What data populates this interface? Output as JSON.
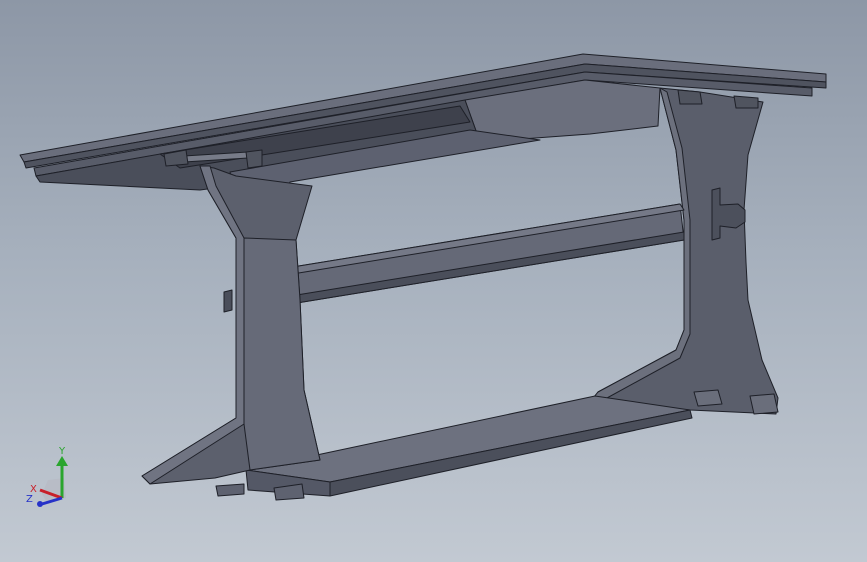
{
  "viewport": {
    "background_top": "#8d97a6",
    "background_bottom": "#c2c9d2"
  },
  "model": {
    "part_color": "#5e6270",
    "edge_color": "#1e2028"
  },
  "triad": {
    "x_label": "X",
    "y_label": "Y",
    "z_label": "Z",
    "x_color": "#c8202a",
    "y_color": "#2aa52e",
    "z_color": "#2632c8"
  }
}
